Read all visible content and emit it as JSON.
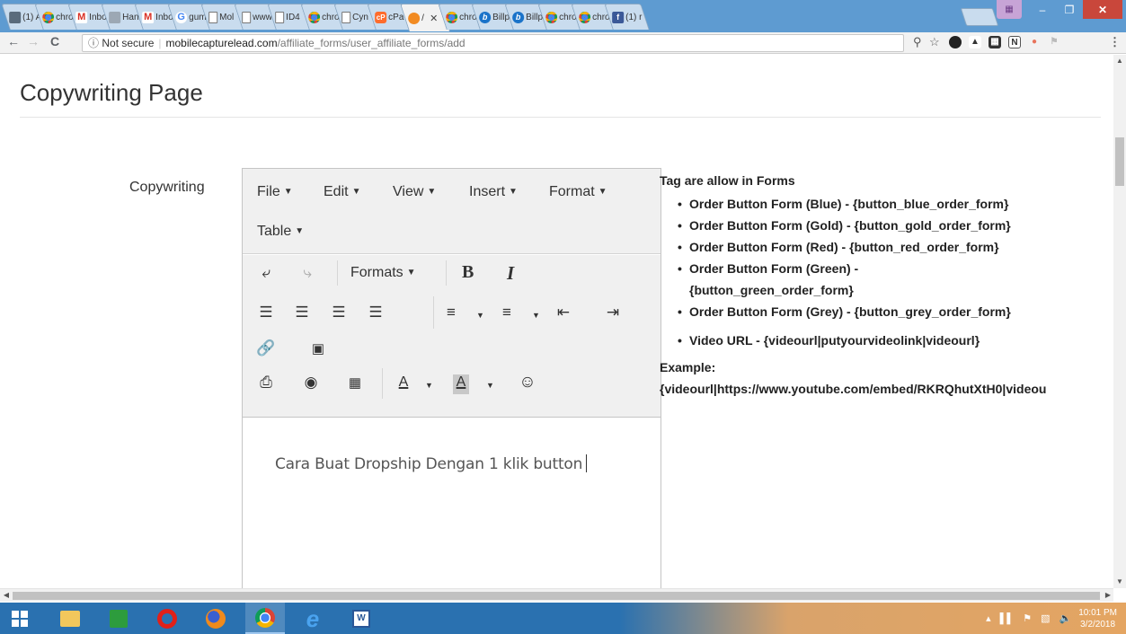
{
  "browser": {
    "tabs": [
      {
        "title": "(1) A",
        "icon": "image-icon"
      },
      {
        "title": "chro",
        "icon": "chrome-icon"
      },
      {
        "title": "Inbo",
        "icon": "gmail-icon"
      },
      {
        "title": "Han",
        "icon": "handshake-icon"
      },
      {
        "title": "Inbo",
        "icon": "gmail-icon"
      },
      {
        "title": "gum",
        "icon": "google-icon"
      },
      {
        "title": "Mol",
        "icon": "document-icon"
      },
      {
        "title": "www",
        "icon": "document-icon"
      },
      {
        "title": "ID4",
        "icon": "document-icon"
      },
      {
        "title": "chro",
        "icon": "chrome-icon"
      },
      {
        "title": "Cyn",
        "icon": "document-icon"
      },
      {
        "title": "cPa",
        "icon": "cpanel-icon"
      },
      {
        "title": "/",
        "icon": "orange-site-icon",
        "active": true
      },
      {
        "title": "chro",
        "icon": "chrome-icon"
      },
      {
        "title": "Billp",
        "icon": "billplz-icon"
      },
      {
        "title": "Billp",
        "icon": "billplz-icon"
      },
      {
        "title": "chro",
        "icon": "chrome-icon"
      },
      {
        "title": "chro",
        "icon": "chrome-icon"
      },
      {
        "title": "(1) r",
        "icon": "facebook-icon"
      }
    ],
    "address": {
      "security_label": "Not secure",
      "host": "mobilecapturelead.com",
      "path": "/affiliate_forms/user_affiliate_forms/add"
    }
  },
  "page": {
    "title": "Copywriting Page",
    "field_label": "Copywriting",
    "editor": {
      "menus": [
        "File",
        "Edit",
        "View",
        "Insert",
        "Format",
        "Table"
      ],
      "formats_label": "Formats",
      "bold_label": "B",
      "italic_label": "I",
      "text_color_label": "A",
      "bg_color_label": "A",
      "content": "Cara Buat Dropship Dengan 1 klik button"
    },
    "help": {
      "title": "Tag are allow in Forms",
      "tags": [
        "Order Button Form (Blue) - {button_blue_order_form}",
        "Order Button Form (Gold) - {button_gold_order_form}",
        "Order Button Form (Red) - {button_red_order_form}",
        "Order Button Form (Green) - {button_green_order_form}",
        "Order Button Form (Grey) - {button_grey_order_form}",
        "Video URL - {videourl|putyourvideolink|videourl}"
      ],
      "example_label": "Example:",
      "example": "{videourl|https://www.youtube.com/embed/RKRQhutXtH0|videou"
    }
  },
  "taskbar": {
    "time": "10:01 PM",
    "date": "3/2/2018"
  }
}
